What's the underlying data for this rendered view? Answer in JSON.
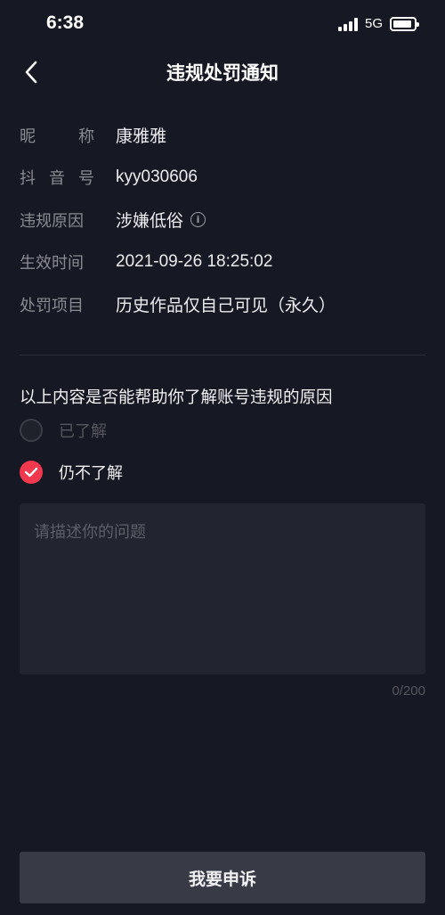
{
  "status_bar": {
    "time": "6:38",
    "network": "5G",
    "battery_level": 0.9
  },
  "nav": {
    "title": "违规处罚通知",
    "back_icon": "chevron-left-icon"
  },
  "info": {
    "nickname": {
      "label_parts": [
        "昵",
        "称"
      ],
      "value": "康雅雅"
    },
    "douyin_id": {
      "label_parts": [
        "抖",
        "音",
        "号"
      ],
      "value": "kyy030606"
    },
    "reason": {
      "label": "违规原因",
      "value": "涉嫌低俗",
      "info_icon": "info-circle-icon"
    },
    "effective_time": {
      "label": "生效时间",
      "value": "2021-09-26 18:25:02"
    },
    "penalty": {
      "label": "处罚项目",
      "value": "历史作品仅自己可见（永久）"
    }
  },
  "feedback": {
    "question": "以上内容是否能帮助你了解账号违规的原因",
    "options": [
      {
        "label": "已了解",
        "checked": false
      },
      {
        "label": "仍不了解",
        "checked": true
      }
    ],
    "placeholder": "请描述你的问题",
    "value": "",
    "counter": "0/200"
  },
  "submit": {
    "label": "我要申诉"
  },
  "colors": {
    "background": "#161823",
    "accent": "#f0384f",
    "button": "#383a46"
  }
}
